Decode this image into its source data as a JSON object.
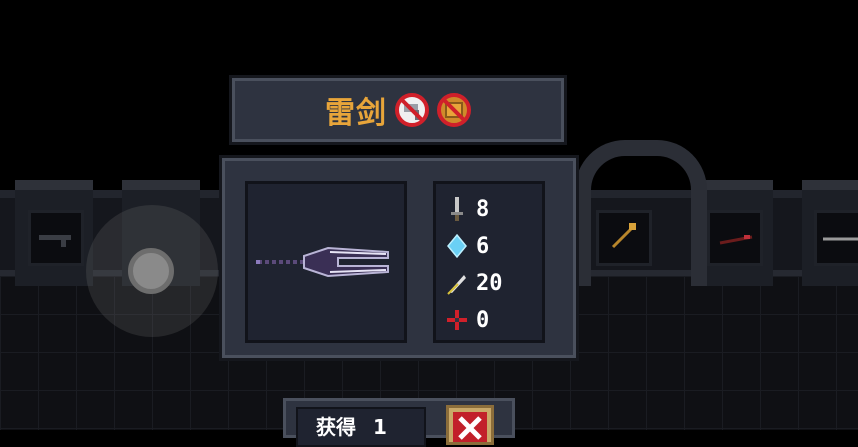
{
  "weapon": {
    "name": "雷剑",
    "restriction_icons": [
      "no-forge-hammer-icon",
      "no-crate-icon"
    ],
    "stats": [
      {
        "icon": "attack-sword-icon",
        "value": "8"
      },
      {
        "icon": "energy-crystal-icon",
        "value": "6"
      },
      {
        "icon": "crit-feather-icon",
        "value": "20"
      },
      {
        "icon": "accuracy-crosshair-icon",
        "value": "0"
      }
    ]
  },
  "pickup": {
    "label": "获得",
    "count": "1"
  },
  "colors": {
    "title": "#e8a53a",
    "panel": "#2e3340",
    "panel_border": "#4a505d",
    "close_button": "#c9a868",
    "close_x": "#c2202a"
  }
}
